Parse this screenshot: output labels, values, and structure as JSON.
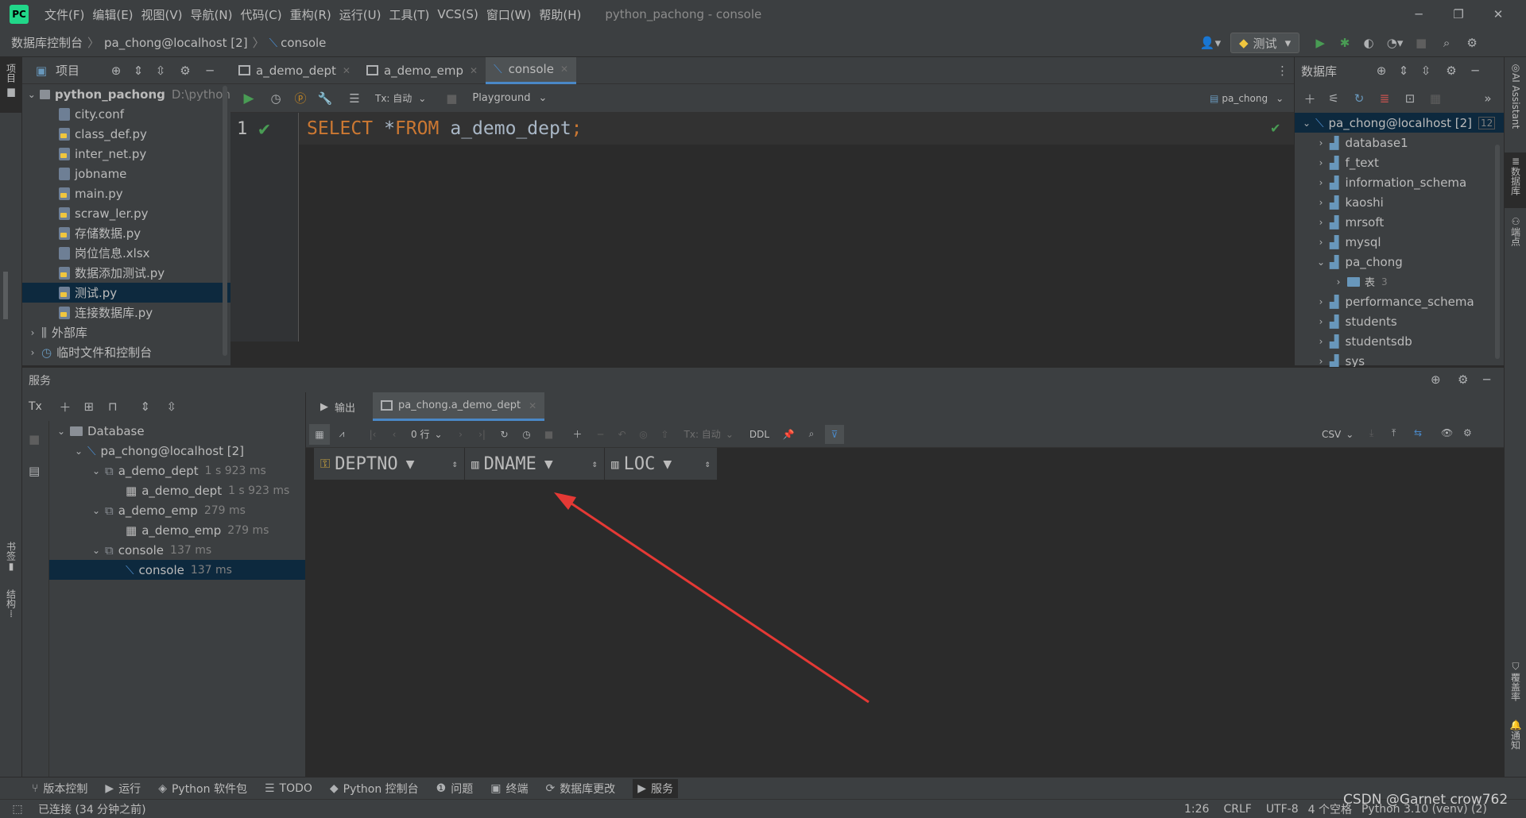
{
  "app": {
    "window_title": "python_pachong - console",
    "menu": [
      "文件(F)",
      "编辑(E)",
      "视图(V)",
      "导航(N)",
      "代码(C)",
      "重构(R)",
      "运行(U)",
      "工具(T)",
      "VCS(S)",
      "窗口(W)",
      "帮助(H)"
    ],
    "run_config": "测试"
  },
  "breadcrumb": [
    "数据库控制台",
    "pa_chong@localhost [2]",
    "console"
  ],
  "project": {
    "title": "项目",
    "root_name": "python_pachong",
    "root_path": "D:\\python",
    "files": [
      {
        "name": "city.conf",
        "type": "file"
      },
      {
        "name": "class_def.py",
        "type": "py"
      },
      {
        "name": "inter_net.py",
        "type": "py"
      },
      {
        "name": "jobname",
        "type": "file"
      },
      {
        "name": "main.py",
        "type": "py"
      },
      {
        "name": "scraw_ler.py",
        "type": "py"
      },
      {
        "name": "存储数据.py",
        "type": "py"
      },
      {
        "name": "岗位信息.xlsx",
        "type": "file"
      },
      {
        "name": "数据添加测试.py",
        "type": "py"
      },
      {
        "name": "测试.py",
        "type": "py",
        "selected": true
      },
      {
        "name": "连接数据库.py",
        "type": "py"
      }
    ],
    "external_libs": "外部库",
    "scratches": "临时文件和控制台"
  },
  "editor": {
    "tabs": [
      {
        "label": "a_demo_dept"
      },
      {
        "label": "a_demo_emp"
      },
      {
        "label": "console",
        "active": true
      }
    ],
    "tx_label": "Tx: 自动",
    "playground_label": "Playground",
    "datasource": "pa_chong",
    "line_number": "1",
    "code": {
      "keyword1": "SELECT",
      "star": "*",
      "keyword2": "FROM",
      "table": "a_demo_dept",
      "semicolon": ";"
    }
  },
  "database": {
    "title": "数据库",
    "root": "pa_chong@localhost [2]",
    "root_count": "12",
    "schemas": [
      {
        "name": "database1",
        "expanded": false
      },
      {
        "name": "f_text",
        "expanded": false
      },
      {
        "name": "information_schema",
        "expanded": false
      },
      {
        "name": "kaoshi",
        "expanded": false
      },
      {
        "name": "mrsoft",
        "expanded": false
      },
      {
        "name": "mysql",
        "expanded": false
      },
      {
        "name": "pa_chong",
        "expanded": true
      },
      {
        "name": "performance_schema",
        "expanded": false
      },
      {
        "name": "students",
        "expanded": false
      },
      {
        "name": "studentsdb",
        "expanded": false
      },
      {
        "name": "sys",
        "expanded": false
      }
    ],
    "tables_node": {
      "label": "表",
      "count": "3"
    }
  },
  "services": {
    "title": "服务",
    "tx": "Tx",
    "tree": {
      "database": "Database",
      "connection": "pa_chong@localhost [2]",
      "nodes": [
        {
          "label": "a_demo_dept",
          "time": "1 s 923 ms",
          "child": "a_demo_dept",
          "child_time": "1 s 923 ms"
        },
        {
          "label": "a_demo_emp",
          "time": "279 ms",
          "child": "a_demo_emp",
          "child_time": "279 ms"
        },
        {
          "label": "console",
          "time": "137 ms",
          "child": "console",
          "child_time": "137 ms"
        }
      ]
    },
    "result_tabs": {
      "output": "输出",
      "result": "pa_chong.a_demo_dept"
    },
    "toolbar": {
      "rows": "0 行",
      "tx": "Tx: 自动",
      "ddl": "DDL",
      "export": "CSV"
    },
    "columns": [
      "DEPTNO",
      "DNAME",
      "LOC"
    ]
  },
  "bottom_tools": [
    {
      "label": "版本控制",
      "icon": "branch-icon"
    },
    {
      "label": "运行",
      "icon": "run-icon"
    },
    {
      "label": "Python 软件包",
      "icon": "package-icon"
    },
    {
      "label": "TODO",
      "icon": "todo-icon"
    },
    {
      "label": "Python 控制台",
      "icon": "python-icon"
    },
    {
      "label": "问题",
      "icon": "problems-icon"
    },
    {
      "label": "终端",
      "icon": "terminal-icon"
    },
    {
      "label": "数据库更改",
      "icon": "db-changes-icon"
    },
    {
      "label": "服务",
      "icon": "services-icon",
      "active": true
    }
  ],
  "status": {
    "left": "已连接 (34 分钟之前)",
    "position": "1:26",
    "line_sep": "CRLF",
    "encoding": "UTF-8",
    "indent": "4 个空格",
    "interpreter": "Python 3.10 (venv) (2)",
    "watermark": "CSDN @Garnet crow762"
  },
  "side_labels": {
    "project": "项目",
    "bookmarks": "书签",
    "structure": "结构",
    "ai": "AI Assistant",
    "db": "数据库",
    "endpoints": "端点",
    "coverage": "覆盖率",
    "notify": "通知"
  },
  "colors": {
    "bg": "#2b2b2b",
    "panel": "#3c3f41",
    "selection": "#0d293e",
    "keyword": "#cc7832",
    "accent": "#4a88c7",
    "check": "#499c54",
    "arrow": "#e53935"
  }
}
